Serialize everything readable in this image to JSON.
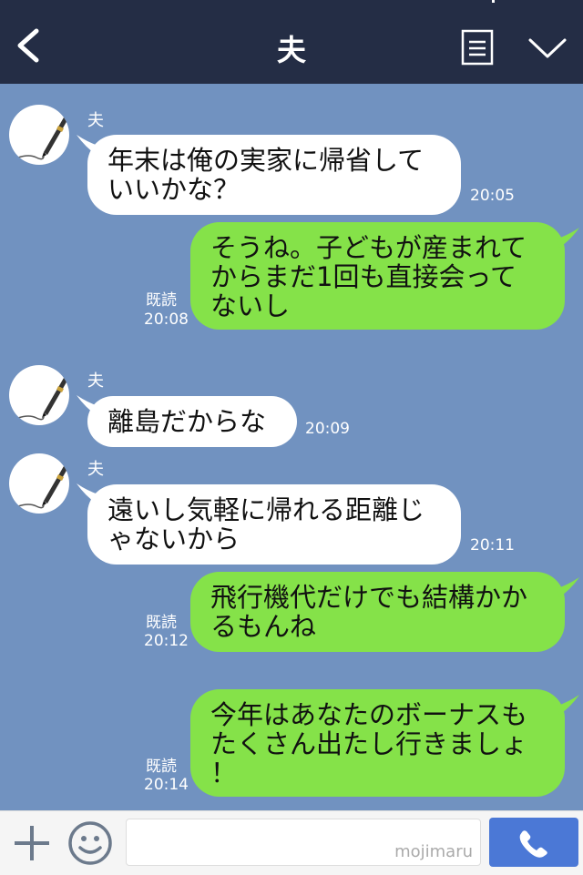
{
  "header": {
    "title": "夫"
  },
  "messages": [
    {
      "sender": "夫",
      "text": "年末は俺の実家に帰省して\nいいかな？",
      "time": "20:05"
    },
    {
      "text": "そうね。子どもが産まれて\nからまだ1回も直接会って\nないし",
      "read": "既読",
      "time": "20:08"
    },
    {
      "sender": "夫",
      "text": "離島だからな",
      "time": "20:09"
    },
    {
      "sender": "夫",
      "text": "遠いし気軽に帰れる距離じ\nゃないから",
      "time": "20:11"
    },
    {
      "text": "飛行機代だけでも結構かか\nるもんね",
      "read": "既読",
      "time": "20:12"
    },
    {
      "text": "今年はあなたのボーナスも\nたくさん出たし行きましょ\n！",
      "read": "既読",
      "time": "20:14"
    }
  ],
  "footer": {
    "watermark": "mojimaru"
  },
  "colors": {
    "header": "#242d45",
    "background": "#7192c0",
    "outgoing": "#85e249",
    "incoming": "#ffffff",
    "call": "#4b78d6"
  }
}
